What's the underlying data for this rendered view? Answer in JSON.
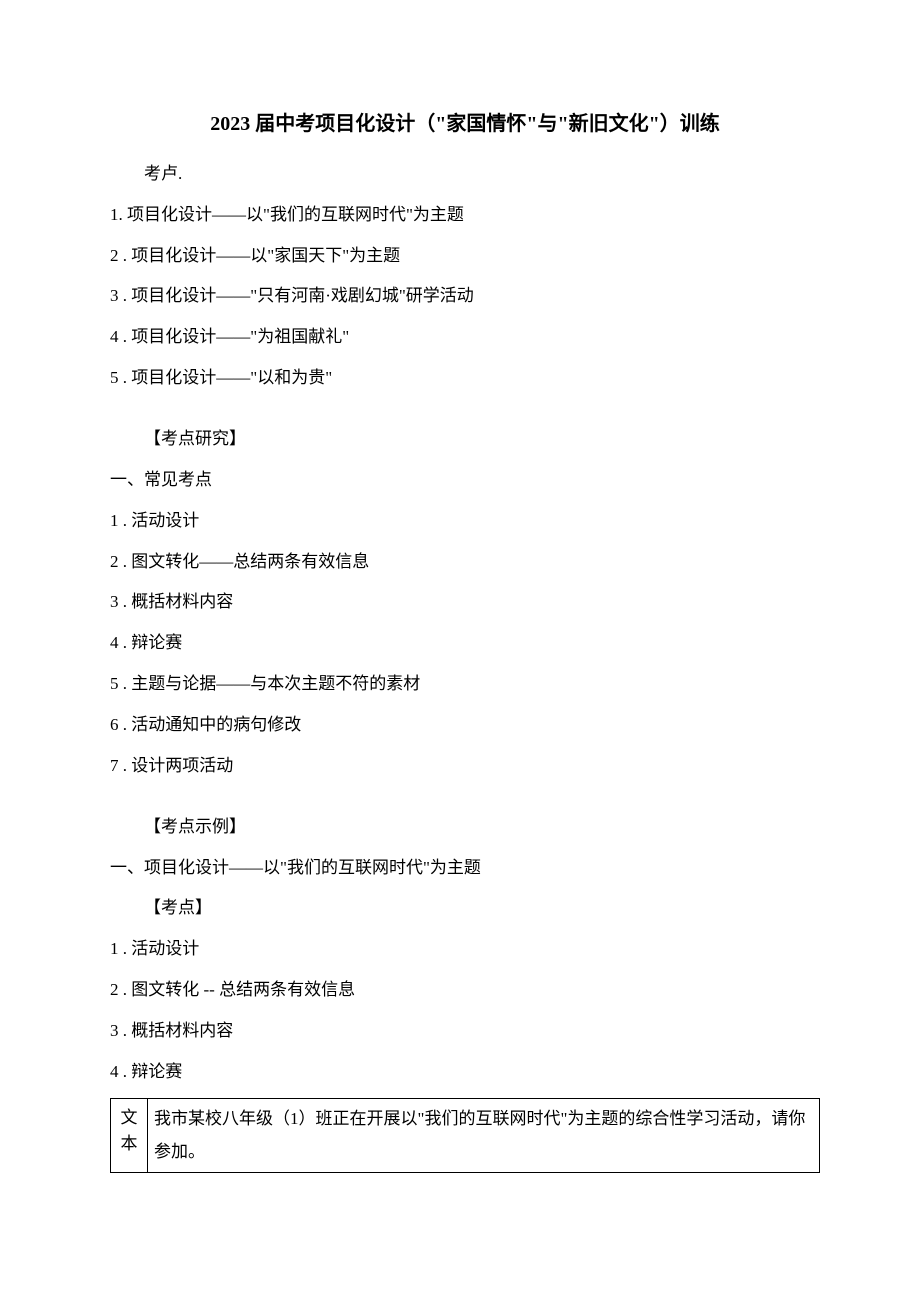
{
  "title": "2023 届中考项目化设计（\"家国情怀\"与\"新旧文化\"）训练",
  "kaolu_label": "考卢.",
  "section1": [
    "1. 项目化设计——以\"我们的互联网时代\"为主题",
    "2 . 项目化设计——以\"家国天下\"为主题",
    "3 . 项目化设计——\"只有河南·戏剧幻城\"研学活动",
    "4 . 项目化设计——\"为祖国献礼\"",
    "5 . 项目化设计——\"以和为贵\""
  ],
  "kaodian_yanjiu_heading": "【考点研究】",
  "common_kaodian_label": "一、常见考点",
  "common_kaodian_items": [
    "1 . 活动设计",
    "2 . 图文转化——总结两条有效信息",
    "3 . 概括材料内容",
    "4 . 辩论赛",
    "5 . 主题与论据——与本次主题不符的素材",
    "6 . 活动通知中的病句修改",
    "7 . 设计两项活动"
  ],
  "kaodian_shili_heading": "【考点示例】",
  "example_title": "一、项目化设计——以\"我们的互联网时代\"为主题",
  "kaodian_label": "【考点】",
  "example_kaodian_items": [
    "1 . 活动设计",
    "2 . 图文转化 -- 总结两条有效信息",
    "3 . 概括材料内容",
    "4 . 辩论赛"
  ],
  "table": {
    "left_top": "文",
    "left_bottom": "本",
    "cell_text": "我市某校八年级（1）班正在开展以\"我们的互联网时代\"为主题的综合性学习活动，请你参加。"
  }
}
